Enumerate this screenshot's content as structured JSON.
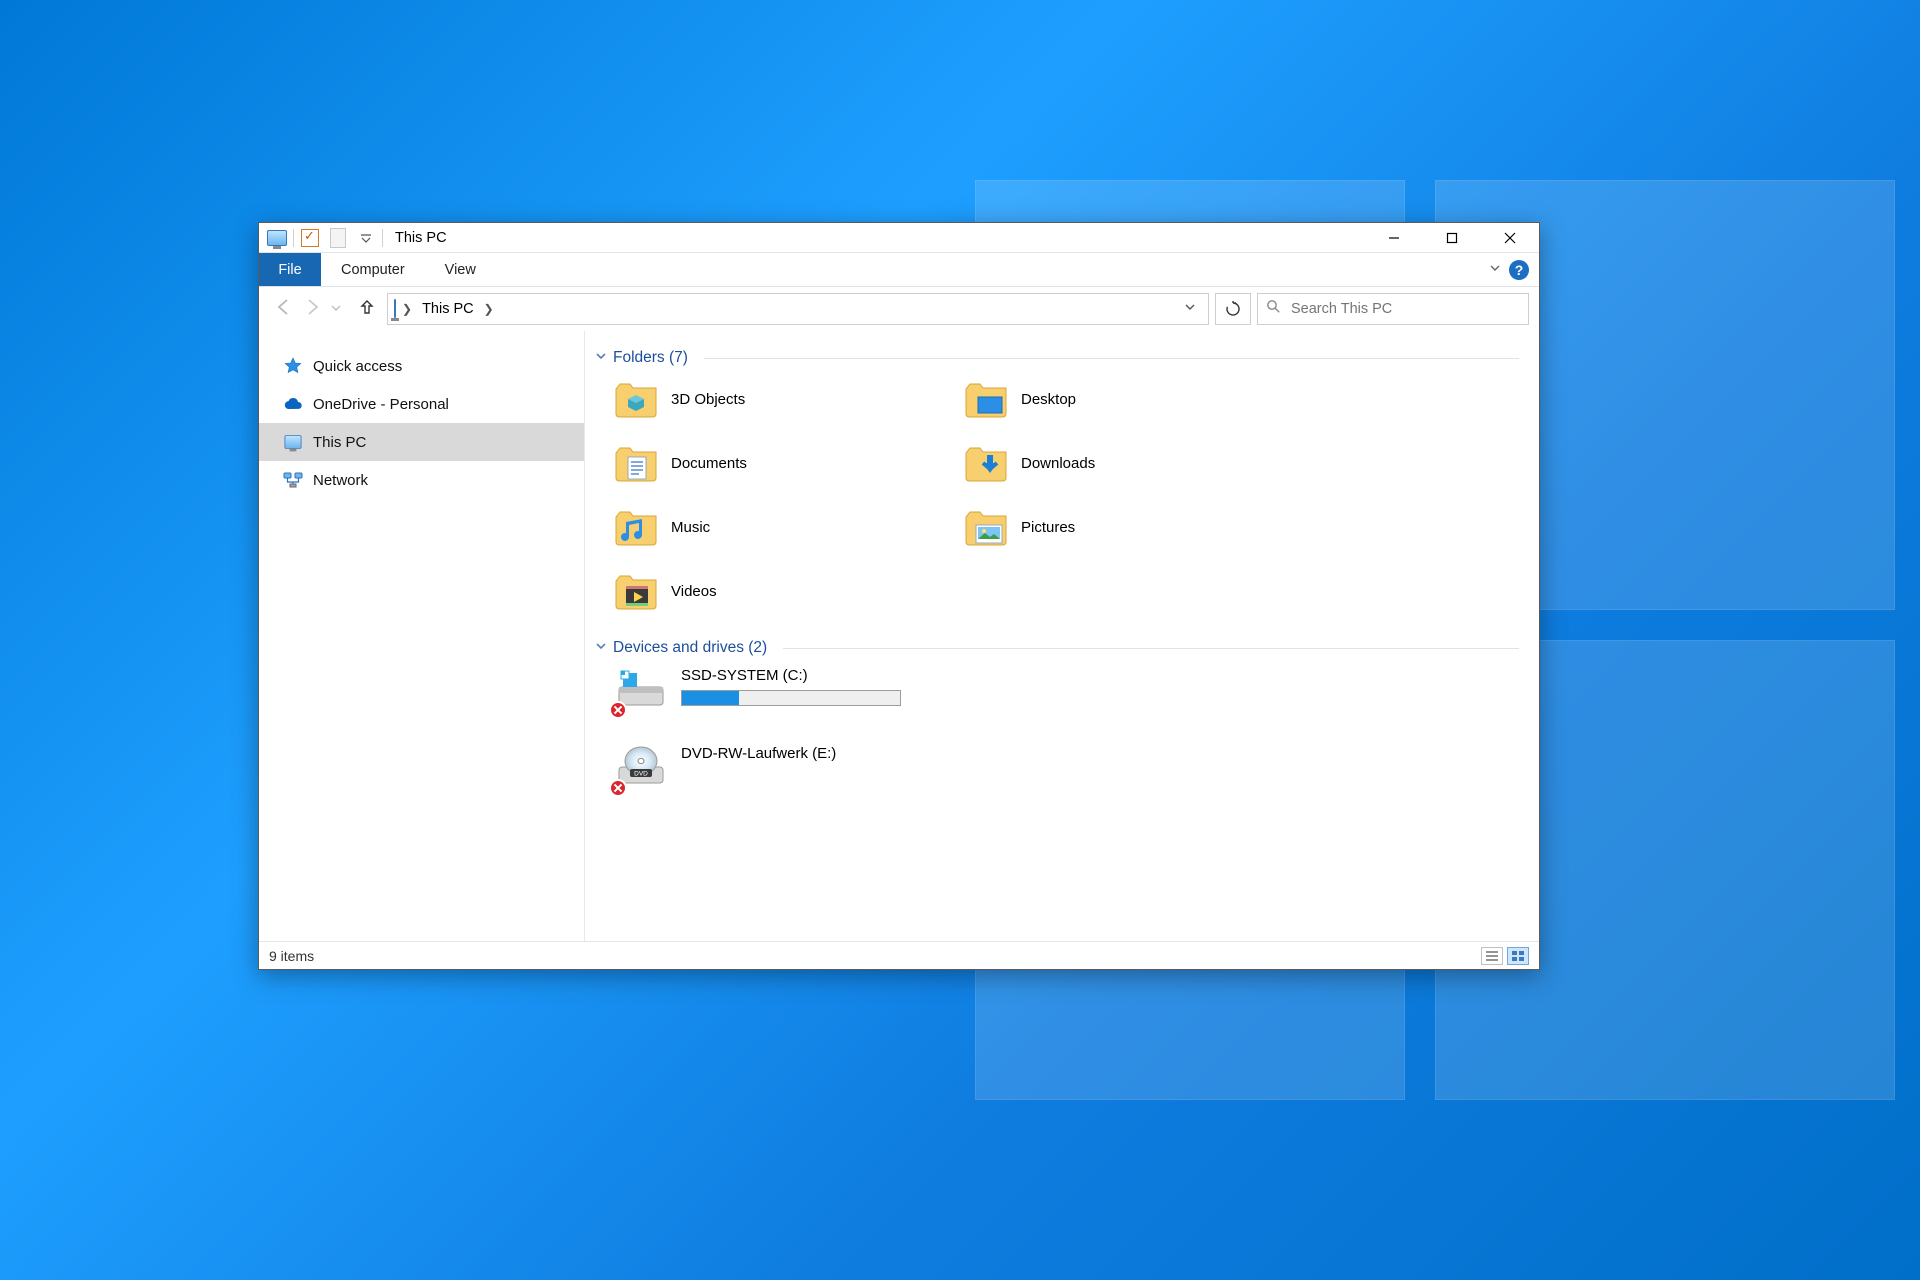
{
  "window": {
    "title": "This PC"
  },
  "ribbon": {
    "file": "File",
    "tabs": [
      "Computer",
      "View"
    ]
  },
  "breadcrumb": {
    "segments": [
      "This PC"
    ]
  },
  "search": {
    "placeholder": "Search This PC"
  },
  "sidebar": {
    "items": [
      {
        "label": "Quick access",
        "icon": "star-icon"
      },
      {
        "label": "OneDrive - Personal",
        "icon": "cloud-icon"
      },
      {
        "label": "This PC",
        "icon": "monitor-icon",
        "selected": true
      },
      {
        "label": "Network",
        "icon": "network-icon"
      }
    ]
  },
  "groups": {
    "folders": {
      "title": "Folders",
      "count": 7,
      "items": [
        {
          "label": "3D Objects",
          "icon": "3d-objects-icon"
        },
        {
          "label": "Desktop",
          "icon": "desktop-folder-icon"
        },
        {
          "label": "Documents",
          "icon": "documents-folder-icon"
        },
        {
          "label": "Downloads",
          "icon": "downloads-folder-icon"
        },
        {
          "label": "Music",
          "icon": "music-folder-icon"
        },
        {
          "label": "Pictures",
          "icon": "pictures-folder-icon"
        },
        {
          "label": "Videos",
          "icon": "videos-folder-icon"
        }
      ]
    },
    "drives": {
      "title": "Devices and drives",
      "count": 2,
      "items": [
        {
          "label": "SSD-SYSTEM (C:)",
          "icon": "ssd-drive-icon",
          "usage_pct": 26,
          "error": true
        },
        {
          "label": "DVD-RW-Laufwerk (E:)",
          "icon": "dvd-drive-icon",
          "error": true
        }
      ]
    }
  },
  "statusbar": {
    "text": "9 items"
  },
  "colors": {
    "accent": "#1867b3",
    "link": "#1b4f9c"
  }
}
